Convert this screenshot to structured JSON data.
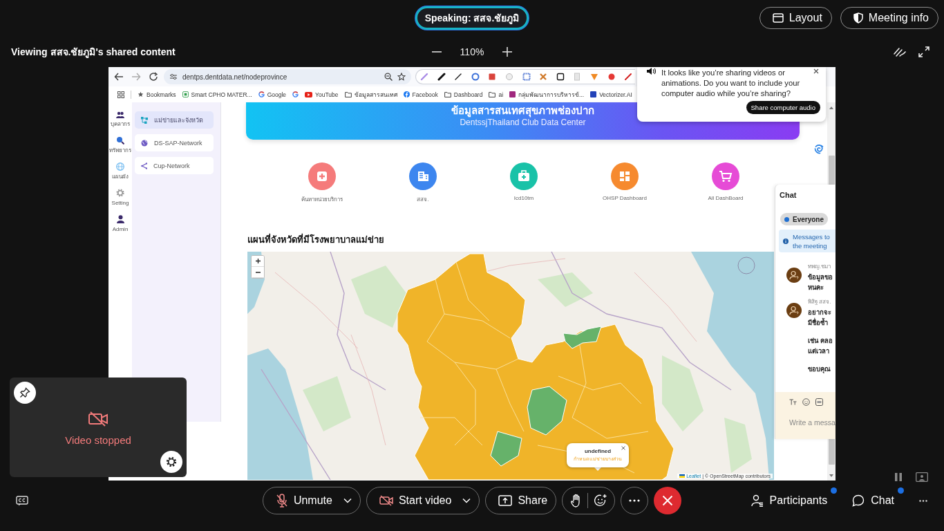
{
  "meeting": {
    "speaking": "Speaking: สสจ.ชัยภูมิ",
    "top_buttons": [
      {
        "kind": "layout",
        "label": "Layout"
      },
      {
        "kind": "info",
        "label": "Meeting info"
      }
    ]
  },
  "share_bar": {
    "viewing": "Viewing สสจ.ชัยภูมิ's shared content",
    "zoom": "110%"
  },
  "browser": {
    "url": "dentps.dentdata.net/nodeprovince",
    "bookmarks": [
      {
        "kind": "star",
        "label": "Bookmarks"
      },
      {
        "kind": "page",
        "label": "Smart CPHO MATER..."
      },
      {
        "kind": "google",
        "label": "Google"
      },
      {
        "kind": "google"
      },
      {
        "kind": "youtube",
        "label": "YouTube"
      },
      {
        "kind": "folder",
        "label": "ข้อมูลสารสนเทศ"
      },
      {
        "kind": "facebook",
        "label": "Facebook"
      },
      {
        "kind": "folder",
        "label": "Dashboard"
      },
      {
        "kind": "folder",
        "label": "ai"
      },
      {
        "kind": "d-tile",
        "label": "กลุ่มพัฒนาการบริหารข้..."
      },
      {
        "kind": "v-tile",
        "label": "Vectorizer.AI"
      }
    ]
  },
  "audio_prompt": {
    "message": "It looks like you’re sharing videos or animations. Do you want to include your computer audio while you’re sharing?",
    "button": "Share computer audio"
  },
  "site": {
    "rail": [
      {
        "kind": "people",
        "label": "บุคลากร"
      },
      {
        "kind": "search",
        "label": "ทรัพยากร"
      },
      {
        "kind": "globe",
        "label": "แผนผัง"
      },
      {
        "kind": "gear",
        "label": "Setting"
      },
      {
        "kind": "person",
        "label": "Admin"
      }
    ],
    "menu": [
      {
        "kind": "network",
        "label": "แม่ข่ายและจังหวัด",
        "selected": true
      },
      {
        "kind": "globe",
        "label": "DS-SAP-Network",
        "selected": false
      },
      {
        "kind": "share",
        "label": "Cup-Network",
        "selected": false
      }
    ],
    "banner": {
      "title": "ข้อมูลสารสนเทศสุขภาพช่องปาก",
      "subtitle": "DentssjThailand Club Data Center"
    },
    "shortcuts": [
      {
        "kind": "medical",
        "label": "ค้นหาหน่วยบริการ",
        "color": "#f57b7b"
      },
      {
        "kind": "building",
        "label": "สสจ.",
        "color": "#3d86ef"
      },
      {
        "kind": "medkit",
        "label": "Icd10tm",
        "color": "#19c2a8"
      },
      {
        "kind": "dashboard",
        "label": "OHSP Dashboard",
        "color": "#f68a2f"
      },
      {
        "kind": "cart",
        "label": "All DashBoard",
        "color": "#e64bd6"
      }
    ],
    "map_title": "แผนที่จังหวัดที่มีโรงพยาบาลแม่ข่าย",
    "map": {
      "popup_title": "undefined",
      "popup_text": "กำหนดแม่ข่ายบางส่วน",
      "attribution_link": "Leaflet",
      "attribution": "| © OpenStreetMap contributors"
    }
  },
  "chat": {
    "title": "Chat",
    "audience": "Everyone",
    "notice": "Messages to the meeting",
    "messages": [
      {
        "sender": "ทพญ.ชมา",
        "lines": [
          "ข้อมูลขอ",
          "หนคะ"
        ]
      },
      {
        "sender": "พิสิฐ สสจ.",
        "lines": [
          "อยากจะ",
          "มีชื่อซ้ำ"
        ]
      },
      {
        "lines": [
          "เช่น คลอ",
          "แต่เวลา"
        ]
      },
      {
        "lines": [
          "ขอบคุณ"
        ]
      }
    ],
    "placeholder": "Write a messa"
  },
  "self_view": {
    "status": "Video stopped"
  },
  "controls": [
    {
      "kind": "mute",
      "label": "Unmute",
      "menu": true
    },
    {
      "kind": "video",
      "label": "Start video",
      "menu": true
    },
    {
      "kind": "share",
      "label": "Share",
      "menu": false
    }
  ],
  "side_panels": [
    {
      "kind": "participants",
      "label": "Participants",
      "badge": true
    },
    {
      "kind": "chat",
      "label": "Chat",
      "badge": true
    }
  ]
}
